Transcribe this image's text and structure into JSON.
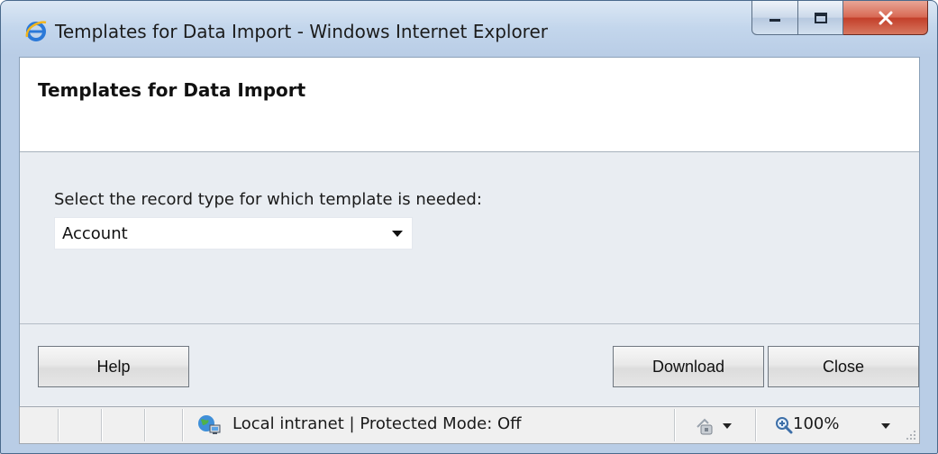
{
  "window": {
    "title": "Templates for Data Import - Windows Internet Explorer"
  },
  "dialog": {
    "title": "Templates for Data Import",
    "prompt": "Select the record type for which template is needed:",
    "record_type": {
      "selected": "Account"
    },
    "buttons": {
      "help": "Help",
      "download": "Download",
      "close": "Close"
    }
  },
  "statusbar": {
    "zone": "Local intranet | Protected Mode: Off",
    "zoom": "100%"
  },
  "icons": {
    "browser": "internet-explorer-icon",
    "zone": "local-intranet-icon",
    "protected": "protected-mode-icon",
    "zoom": "zoom-icon",
    "minimize": "minimize-icon",
    "maximize": "maximize-icon",
    "close": "close-icon"
  },
  "colors": {
    "close_button": "#c3402b",
    "frame": "#b9cde6",
    "content_bg": "#e9edf2"
  }
}
